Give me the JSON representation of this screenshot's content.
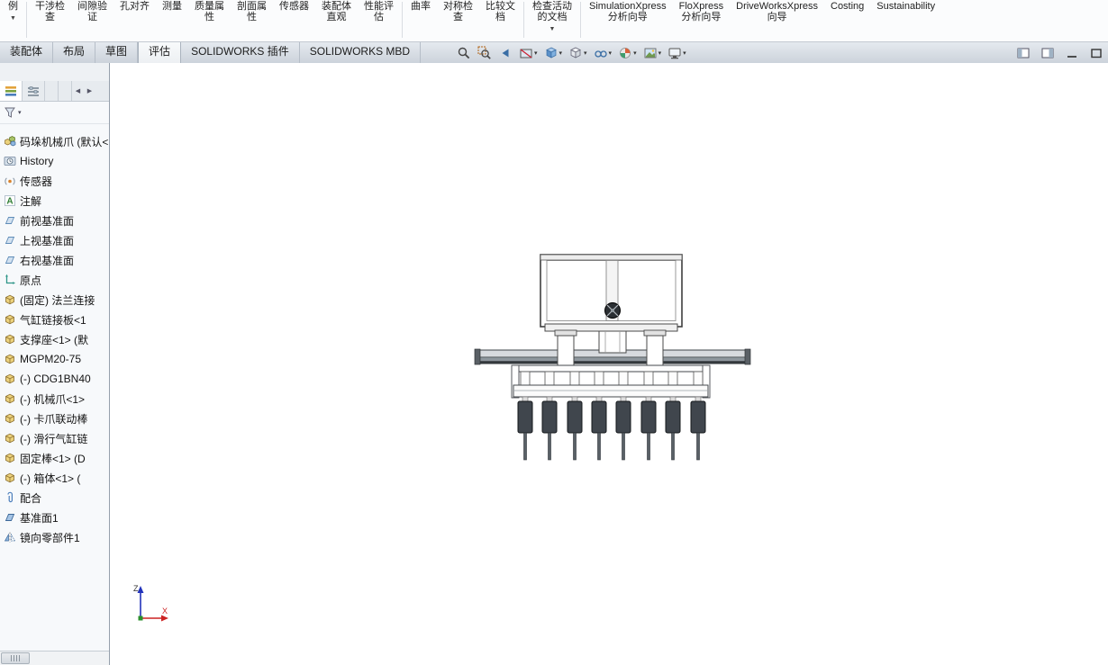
{
  "icons": {
    "caret_down_small": "▼",
    "caret_down": "▾",
    "arrow_left": "◀",
    "arrow_right": "▶",
    "collapse_left": "◀"
  },
  "ribbon": {
    "partial": {
      "label": "例"
    },
    "buttons": [
      {
        "label": "干涉检\n查"
      },
      {
        "label": "间隙验\n证"
      },
      {
        "label": "孔对齐"
      },
      {
        "label": "测量"
      },
      {
        "label": "质量属\n性"
      },
      {
        "label": "剖面属\n性"
      },
      {
        "label": "传感器"
      },
      {
        "label": "装配体\n直观"
      },
      {
        "label": "性能评\n估"
      },
      {
        "label": "曲率"
      },
      {
        "label": "对称检\n查"
      },
      {
        "label": "比较文\n档"
      },
      {
        "label": "检查活动\n的文档"
      },
      {
        "label": "SimulationXpress\n分析向导"
      },
      {
        "label": "FloXpress\n分析向导"
      },
      {
        "label": "DriveWorksXpress\n向导"
      },
      {
        "label": "Costing"
      },
      {
        "label": "Sustainability"
      }
    ]
  },
  "tabs": [
    {
      "label": "装配体"
    },
    {
      "label": "布局"
    },
    {
      "label": "草图"
    },
    {
      "label": "评估"
    },
    {
      "label": "SOLIDWORKS 插件"
    },
    {
      "label": "SOLIDWORKS MBD"
    }
  ],
  "heads_up": {
    "icons": [
      "zoom-to-fit",
      "zoom-to-area",
      "previous-view",
      "section-view",
      "view-orientation",
      "display-style",
      "hide-show-items",
      "edit-appearance",
      "apply-scene",
      "view-settings"
    ]
  },
  "tree": {
    "items": [
      {
        "label": "码垛机械爪 (默认<",
        "icon": "assembly"
      },
      {
        "label": "History",
        "icon": "history"
      },
      {
        "label": "传感器",
        "icon": "sensors"
      },
      {
        "label": "注解",
        "icon": "annotations"
      },
      {
        "label": "前视基准面",
        "icon": "plane"
      },
      {
        "label": "上视基准面",
        "icon": "plane"
      },
      {
        "label": "右视基准面",
        "icon": "plane"
      },
      {
        "label": "原点",
        "icon": "origin"
      },
      {
        "label": "(固定) 法兰连接",
        "icon": "part"
      },
      {
        "label": "气缸链接板<1",
        "icon": "part"
      },
      {
        "label": "支撑座<1> (默",
        "icon": "part"
      },
      {
        "label": "MGPM20-75",
        "icon": "part"
      },
      {
        "label": "(-) CDG1BN40",
        "icon": "part"
      },
      {
        "label": "(-) 机械爪<1>",
        "icon": "part"
      },
      {
        "label": "(-) 卡爪联动棒",
        "icon": "part"
      },
      {
        "label": "(-) 滑行气缸链",
        "icon": "part"
      },
      {
        "label": "固定棒<1> (D",
        "icon": "part"
      },
      {
        "label": "(-) 箱体<1> (",
        "icon": "part"
      },
      {
        "label": "配合",
        "icon": "mates"
      },
      {
        "label": "基准面1",
        "icon": "plane-feature"
      },
      {
        "label": "镜向零部件1",
        "icon": "mirror"
      }
    ]
  },
  "viewport": {
    "triad": {
      "z_label": "Z",
      "x_label": "X"
    }
  }
}
